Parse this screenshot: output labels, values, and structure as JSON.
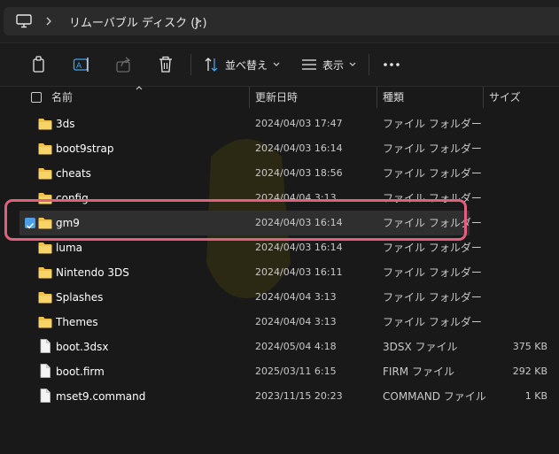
{
  "address": {
    "breadcrumb": "リムーバブル ディスク (J:)",
    "root_icon": "computer-icon"
  },
  "toolbar": {
    "sort_label": "並べ替え",
    "view_label": "表示"
  },
  "columns": {
    "name": "名前",
    "date": "更新日時",
    "type": "種類",
    "size": "サイズ"
  },
  "colors": {
    "accent": "#4a9fe8",
    "highlight_border": "#e0607e",
    "folder": "#f0c24a",
    "background": "#191919"
  },
  "rows": [
    {
      "name": "3ds",
      "date": "2024/04/03 17:47",
      "type": "ファイル フォルダー",
      "size": "",
      "icon": "folder-icon"
    },
    {
      "name": "boot9strap",
      "date": "2024/04/03 16:14",
      "type": "ファイル フォルダー",
      "size": "",
      "icon": "folder-icon"
    },
    {
      "name": "cheats",
      "date": "2024/04/03 18:56",
      "type": "ファイル フォルダー",
      "size": "",
      "icon": "folder-icon"
    },
    {
      "name": "config",
      "date": "2024/04/04 3:13",
      "type": "ファイル フォルダー",
      "size": "",
      "icon": "folder-icon"
    },
    {
      "name": "gm9",
      "date": "2024/04/03 16:14",
      "type": "ファイル フォルダー",
      "size": "",
      "icon": "folder-icon",
      "selected": true
    },
    {
      "name": "luma",
      "date": "2024/04/03 16:14",
      "type": "ファイル フォルダー",
      "size": "",
      "icon": "folder-icon"
    },
    {
      "name": "Nintendo 3DS",
      "date": "2024/04/03 16:11",
      "type": "ファイル フォルダー",
      "size": "",
      "icon": "folder-icon"
    },
    {
      "name": "Splashes",
      "date": "2024/04/04 3:13",
      "type": "ファイル フォルダー",
      "size": "",
      "icon": "folder-icon"
    },
    {
      "name": "Themes",
      "date": "2024/04/04 3:13",
      "type": "ファイル フォルダー",
      "size": "",
      "icon": "folder-icon"
    },
    {
      "name": "boot.3dsx",
      "date": "2024/05/04 4:18",
      "type": "3DSX ファイル",
      "size": "375 KB",
      "icon": "file-icon"
    },
    {
      "name": "boot.firm",
      "date": "2025/03/11 6:15",
      "type": "FIRM ファイル",
      "size": "292 KB",
      "icon": "file-icon"
    },
    {
      "name": "mset9.command",
      "date": "2023/11/15 20:23",
      "type": "COMMAND ファイル",
      "size": "1 KB",
      "icon": "file-icon"
    }
  ]
}
